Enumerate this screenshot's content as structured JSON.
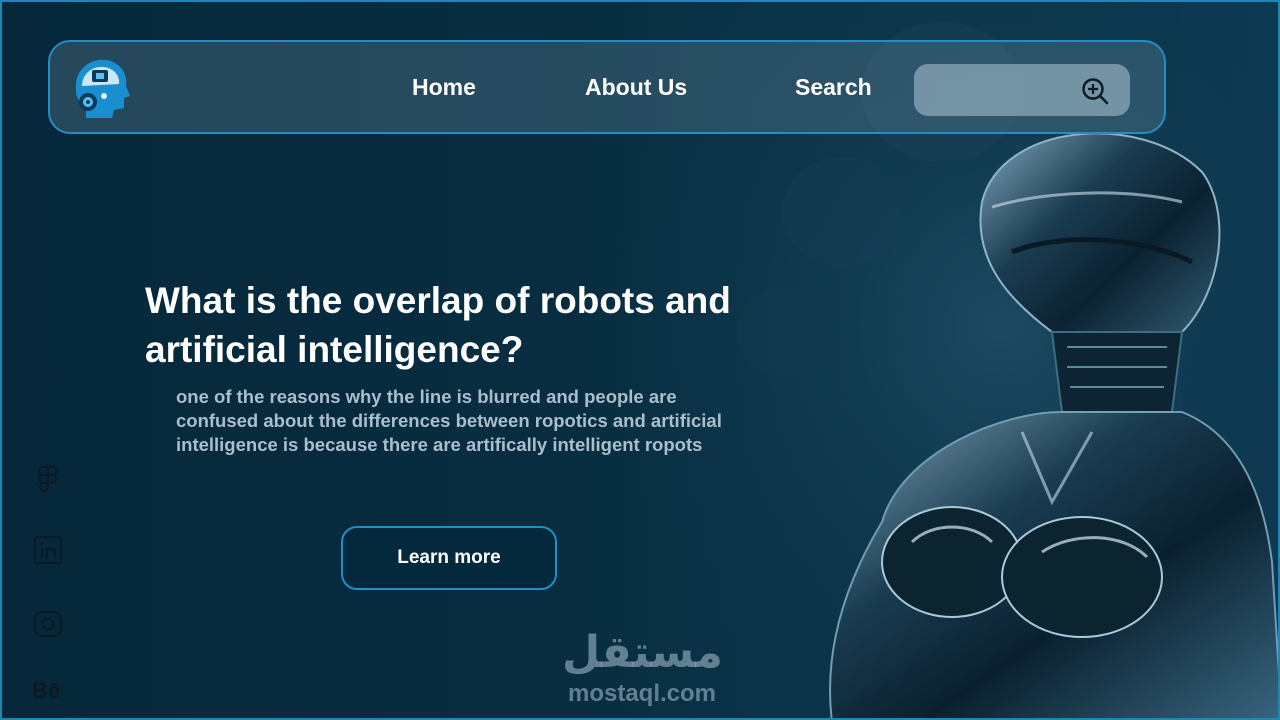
{
  "nav": {
    "links": [
      {
        "label": "Home"
      },
      {
        "label": "About Us"
      },
      {
        "label": "Search"
      }
    ],
    "search": {
      "placeholder": "",
      "value": ""
    }
  },
  "hero": {
    "headline_line1": "What is the overlap of robots and",
    "headline_line2": "artificial intelligence?",
    "description_line1": "one of the reasons why the line is blurred and people are",
    "description_line2": "confused about the differences between ropotics and artificial",
    "description_line3": "intelligence is because there are artifically intelligent ropots",
    "cta_label": "Learn more"
  },
  "social": {
    "icons": [
      "figma-icon",
      "linkedin-icon",
      "instagram-icon",
      "behance-icon"
    ],
    "behance_text": "Bē"
  },
  "watermark": {
    "arabic": "مستقل",
    "latin": "mostaql.com"
  },
  "colors": {
    "background": "#06293b",
    "accent_border": "#1f8fc4",
    "button_bg": "#04293d",
    "text_primary": "#ffffff",
    "text_secondary": "#a9bfcc"
  }
}
